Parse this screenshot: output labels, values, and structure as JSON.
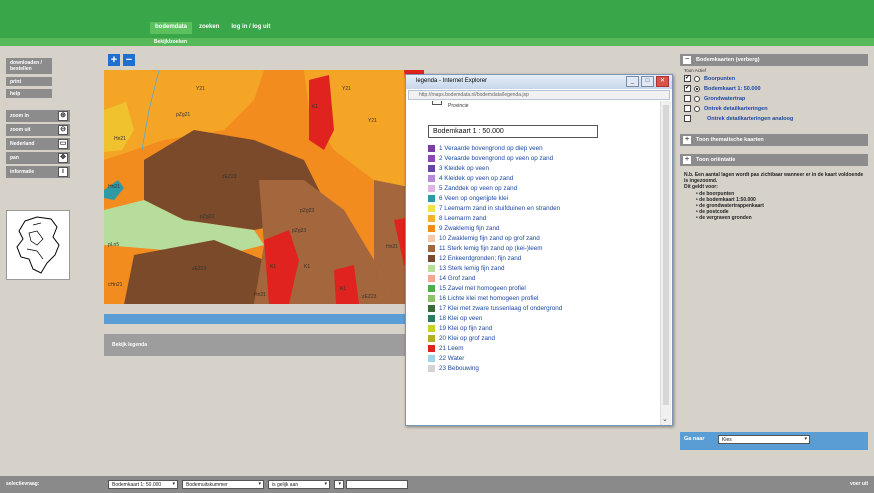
{
  "topnav": {
    "items": [
      "bodemdata",
      "zoeken",
      "log in / log uit"
    ],
    "active": "bodemdata",
    "sub_item": "Bekijk/zoeken"
  },
  "sidebar": {
    "items": [
      "downloaden / bestellen",
      "print",
      "help"
    ],
    "tools": [
      {
        "label": "zoom in",
        "icon": "zoom-in-icon"
      },
      {
        "label": "zoom uit",
        "icon": "zoom-out-icon"
      },
      {
        "label": "Nederland",
        "icon": "country-icon"
      },
      {
        "label": "pan",
        "icon": "pan-icon"
      },
      {
        "label": "informatie",
        "icon": "info-icon"
      }
    ]
  },
  "map": {
    "labels": [
      "Y21",
      "Y21",
      "Y21",
      "K1",
      "pZg21",
      "Hn21",
      "Hn21",
      "zEZ23",
      "pZg23",
      "pZg23",
      "zEZ23",
      "K1",
      "K1",
      "pLn5",
      "Hn21",
      "cHn21",
      "Hn21",
      "K1",
      "zEZ23",
      "pZg23"
    ],
    "legend_toggle": "Bekijk legenda"
  },
  "popup": {
    "title": "legenda - Internet Explorer",
    "url": "http://maps.bodemdata.nl/bodemdata/legenda.jsp",
    "provincie": "Provincie",
    "selected": "Bodemkaart 1 : 50.000",
    "legend": [
      {
        "label": "1 Veraarde bovengrond op diep veen",
        "color": "#7c3fa0"
      },
      {
        "label": "2 Veraarde bovengrond op veen op zand",
        "color": "#8e47b4"
      },
      {
        "label": "3 Kleidek op veen",
        "color": "#6645a5"
      },
      {
        "label": "4 Kleidek op veen op zand",
        "color": "#b78ad6"
      },
      {
        "label": "5 Zanddek op veen op zand",
        "color": "#e0b4e3"
      },
      {
        "label": "6 Veen op ongerijpte klei",
        "color": "#2e9aa5"
      },
      {
        "label": "7 Leemarm zand in stuifduinen en stranden",
        "color": "#f0e44a"
      },
      {
        "label": "8 Leemarm zand",
        "color": "#f5b22a"
      },
      {
        "label": "9 Zwaklemig fijn zand",
        "color": "#f28c1f"
      },
      {
        "label": "10 Zwaklemig fijn zand op grof zand",
        "color": "#f7c8a6"
      },
      {
        "label": "11 Sterk lemig fijn zand op (kei-)leem",
        "color": "#a4663c"
      },
      {
        "label": "12 Enkeerdgronden; fijn zand",
        "color": "#7a4a2a"
      },
      {
        "label": "13 Sterk lemig fijn zand",
        "color": "#b7dd9c"
      },
      {
        "label": "14 Grof zand",
        "color": "#f2a88c"
      },
      {
        "label": "15 Zavel met homogeen profiel",
        "color": "#4fae49"
      },
      {
        "label": "16 Lichte klei met homogeen profiel",
        "color": "#8cc26a"
      },
      {
        "label": "17 Klei met zware tussenlaag of ondergrond",
        "color": "#3b6b3a"
      },
      {
        "label": "18 Klei op veen",
        "color": "#2a7a64"
      },
      {
        "label": "19 Klei op fijn zand",
        "color": "#c7d12a"
      },
      {
        "label": "20 Klei op grof zand",
        "color": "#b4b025"
      },
      {
        "label": "21 Leem",
        "color": "#e0231f"
      },
      {
        "label": "22 Water",
        "color": "#9fd4ea"
      },
      {
        "label": "23 Bebouwing",
        "color": "#d4d4d4"
      }
    ]
  },
  "right_panel": {
    "header1": "Bodemkaarten (verberg)",
    "toon_actief": "Toon Actief",
    "layers": [
      {
        "label": "Boorpunten",
        "checked": true,
        "radio": false
      },
      {
        "label": "Bodemkaart 1: 50.000",
        "checked": true,
        "radio": true
      },
      {
        "label": "Grondwatertrap",
        "checked": false,
        "radio": false
      },
      {
        "label": "Ontrek detailkarteringen",
        "checked": false,
        "radio": false
      },
      {
        "label": "Ontrek detailkarteringen analoog",
        "checked": false,
        "radio": false
      }
    ],
    "header2": "Toon thematische kaarten",
    "header3": "Toon oriëntatie",
    "note": "N.b. Een aantal lagen wordt pas zichtbaar wanneer er in de kaart voldoende is ingezoomd.",
    "note2": "Dit geldt voor:",
    "note_items": [
      "de boorpunten",
      "de bodemkaart 1:50.000",
      "de grondwatertrappenkaart",
      "de postcode",
      "de vergraven gronden"
    ],
    "ga_naar_label": "Ga naar",
    "ga_naar_value": "Kies"
  },
  "footer": {
    "label": "selectievraag:",
    "selects": [
      "Bodemkaart 1: 50.000",
      "Bodemuitskummer",
      "is gelijk aan",
      ""
    ],
    "right": "voer uit"
  },
  "colors": {
    "green": "#3aa64a",
    "blue": "#5a9dd5",
    "gray": "#8c8c8c"
  }
}
